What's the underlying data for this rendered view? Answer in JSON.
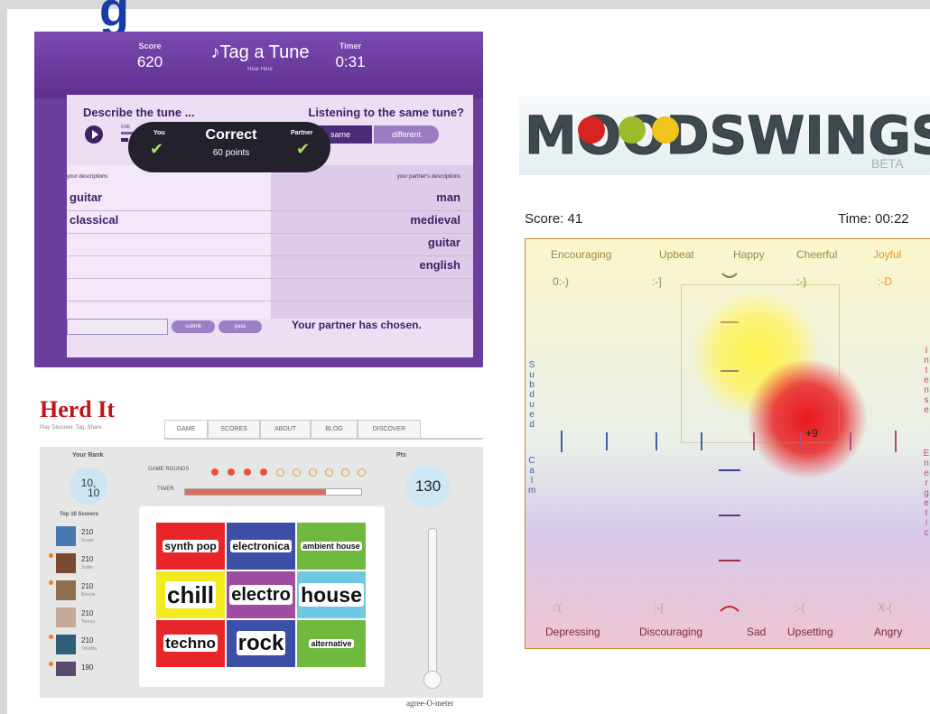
{
  "page": {
    "title_partial": "g"
  },
  "tag_a_tune": {
    "score_label": "Score",
    "score_value": "620",
    "title": "♪Tag a Tune",
    "subtitle": "Hear Here",
    "timer_label": "Timer",
    "timer_value": "0:31",
    "describe_label": "Describe the tune ...",
    "listening_label": "Listening to the same tune?",
    "same_label": "same",
    "different_label": "different",
    "player_time": "0:06",
    "your_descriptions_label": "your descriptions",
    "partner_descriptions_label": "your partner's descriptions",
    "your_descriptions": [
      "guitar",
      "classical"
    ],
    "partner_descriptions": [
      "man",
      "medieval",
      "guitar",
      "english"
    ],
    "feedback": {
      "you": "You",
      "partner": "Partner",
      "result": "Correct",
      "points": "60 points"
    },
    "submit_label": "submit",
    "pass_label": "pass",
    "partner_status": "Your partner has chosen."
  },
  "herd_it": {
    "logo": "Herd It",
    "tagline": "Play Discover. Tag. Share",
    "tabs": [
      "GAME",
      "SCORES",
      "ABOUT",
      "BLOG",
      "DISCOVER"
    ],
    "your_rank_label": "Your Rank",
    "rank_value": "10,",
    "rank_total": "10",
    "game rounds_label": "GAME ROUNDS",
    "game_rounds_label": "GAME ROUNDS",
    "rounds_total": 10,
    "rounds_completed": 4,
    "timer_label": "TIMER",
    "timer_fraction": 0.8,
    "points_label": "Pts",
    "points_value": "130",
    "top_scores_label": "Top 10 Scorers",
    "top_scores": [
      {
        "score": "210",
        "name": "Susan"
      },
      {
        "score": "210",
        "name": "Justin"
      },
      {
        "score": "210",
        "name": "Bonnie"
      },
      {
        "score": "210",
        "name": "Tereza"
      },
      {
        "score": "210",
        "name": "Timothy"
      },
      {
        "score": "190",
        "name": ""
      }
    ],
    "tags": [
      {
        "label": "synth pop",
        "color": "#e8262a"
      },
      {
        "label": "electronica",
        "color": "#3c4fa6"
      },
      {
        "label": "ambient house",
        "color": "#6fb93f"
      },
      {
        "label": "chill",
        "color": "#f2ea1f"
      },
      {
        "label": "electro",
        "color": "#9d4ea1"
      },
      {
        "label": "house",
        "color": "#6ec8e4"
      },
      {
        "label": "techno",
        "color": "#e8262a"
      },
      {
        "label": "rock",
        "color": "#3c4fa6"
      },
      {
        "label": "alternative",
        "color": "#6fb93f"
      }
    ],
    "meter_label": "agree-O-meter"
  },
  "moodswings": {
    "logo": "MOODSWINGS",
    "beta": "BETA",
    "score_label": "Score: 41",
    "time_label": "Time: 00:22",
    "top_moods": [
      "Encouraging",
      "Upbeat",
      "Happy",
      "Cheerful",
      "Joyful"
    ],
    "top_emoticons": [
      "0:-)",
      ":-]",
      ":-}",
      ":-D"
    ],
    "bottom_moods": [
      "Depressing",
      "Discouraging",
      "Sad",
      "Upsetting",
      "Angry"
    ],
    "bottom_emoticons": [
      ":'(",
      ":-[",
      ":-(",
      "X-("
    ],
    "left_axis_top": "Subdued",
    "left_axis_bottom": "Calm",
    "right_axis_top": "Intense",
    "right_axis_bottom": "Energetic",
    "cursor_value": "+9"
  }
}
